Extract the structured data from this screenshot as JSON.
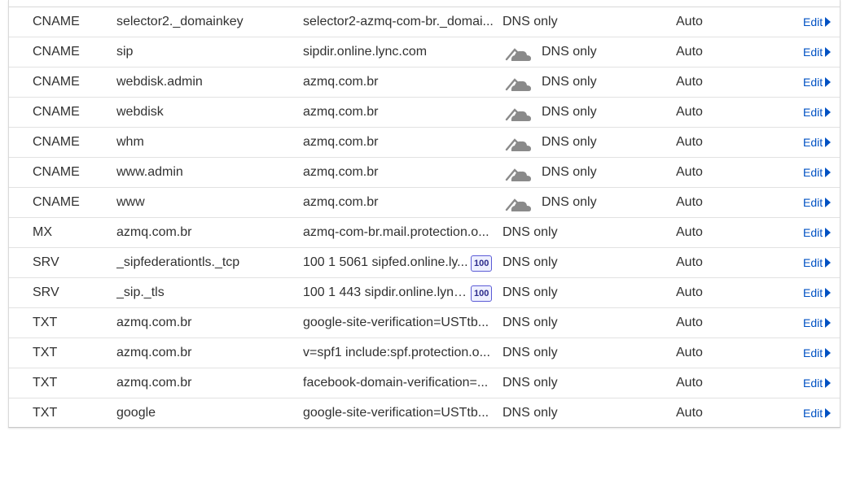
{
  "colors": {
    "link": "#0051c3",
    "cloud_grey": "#8a8a8a",
    "badge_border": "#5b5bd6"
  },
  "records": [
    {
      "type": "CNAME",
      "name": "selector2._domainkey",
      "content": "selector2-azmq-com-br._domai...",
      "proxy": "DNS only",
      "ttl": "Auto",
      "edit": "Edit",
      "cloud_icon": false,
      "priority": ""
    },
    {
      "type": "CNAME",
      "name": "sip",
      "content": "sipdir.online.lync.com",
      "proxy": "DNS only",
      "ttl": "Auto",
      "edit": "Edit",
      "cloud_icon": true,
      "priority": ""
    },
    {
      "type": "CNAME",
      "name": "webdisk.admin",
      "content": "azmq.com.br",
      "proxy": "DNS only",
      "ttl": "Auto",
      "edit": "Edit",
      "cloud_icon": true,
      "priority": ""
    },
    {
      "type": "CNAME",
      "name": "webdisk",
      "content": "azmq.com.br",
      "proxy": "DNS only",
      "ttl": "Auto",
      "edit": "Edit",
      "cloud_icon": true,
      "priority": ""
    },
    {
      "type": "CNAME",
      "name": "whm",
      "content": "azmq.com.br",
      "proxy": "DNS only",
      "ttl": "Auto",
      "edit": "Edit",
      "cloud_icon": true,
      "priority": ""
    },
    {
      "type": "CNAME",
      "name": "www.admin",
      "content": "azmq.com.br",
      "proxy": "DNS only",
      "ttl": "Auto",
      "edit": "Edit",
      "cloud_icon": true,
      "priority": ""
    },
    {
      "type": "CNAME",
      "name": "www",
      "content": "azmq.com.br",
      "proxy": "DNS only",
      "ttl": "Auto",
      "edit": "Edit",
      "cloud_icon": true,
      "priority": ""
    },
    {
      "type": "MX",
      "name": "azmq.com.br",
      "content": "azmq-com-br.mail.protection.o...",
      "proxy": "DNS only",
      "ttl": "Auto",
      "edit": "Edit",
      "cloud_icon": false,
      "priority": ""
    },
    {
      "type": "SRV",
      "name": "_sipfederationtls._tcp",
      "content": "100 1 5061 sipfed.online.ly...",
      "proxy": "DNS only",
      "ttl": "Auto",
      "edit": "Edit",
      "cloud_icon": false,
      "priority": "100"
    },
    {
      "type": "SRV",
      "name": "_sip._tls",
      "content": "100 1 443 sipdir.online.lync...",
      "proxy": "DNS only",
      "ttl": "Auto",
      "edit": "Edit",
      "cloud_icon": false,
      "priority": "100"
    },
    {
      "type": "TXT",
      "name": "azmq.com.br",
      "content": "google-site-verification=USTtb...",
      "proxy": "DNS only",
      "ttl": "Auto",
      "edit": "Edit",
      "cloud_icon": false,
      "priority": ""
    },
    {
      "type": "TXT",
      "name": "azmq.com.br",
      "content": "v=spf1 include:spf.protection.o...",
      "proxy": "DNS only",
      "ttl": "Auto",
      "edit": "Edit",
      "cloud_icon": false,
      "priority": ""
    },
    {
      "type": "TXT",
      "name": "azmq.com.br",
      "content": "facebook-domain-verification=...",
      "proxy": "DNS only",
      "ttl": "Auto",
      "edit": "Edit",
      "cloud_icon": false,
      "priority": ""
    },
    {
      "type": "TXT",
      "name": "google",
      "content": "google-site-verification=USTtb...",
      "proxy": "DNS only",
      "ttl": "Auto",
      "edit": "Edit",
      "cloud_icon": false,
      "priority": ""
    }
  ]
}
